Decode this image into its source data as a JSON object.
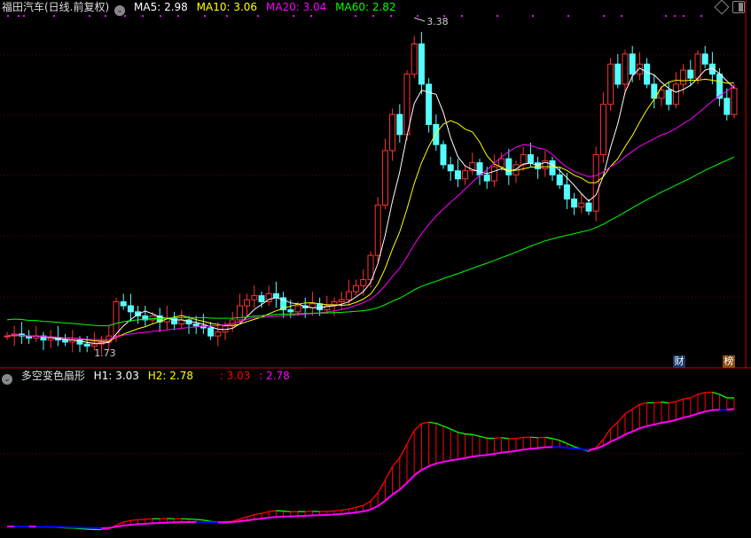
{
  "header": {
    "title": "福田汽车(日线.前复权)",
    "ma5": "MA5: 2.98",
    "ma10": "MA10: 3.06",
    "ma20": "MA20: 3.04",
    "ma60": "MA60: 2.82"
  },
  "indicator": {
    "title": "多空变色扇形",
    "h1": "H1: 3.03",
    "h2": "H2: 2.78",
    "v1": ": 3.03",
    "v2": ": 2.78"
  },
  "annotations": {
    "high": "3.38",
    "low": "1.73"
  },
  "badges": {
    "finance": "财",
    "rank": "榜"
  },
  "colors": {
    "up": "#ff3232",
    "down": "#54ffff",
    "ma5": "#ffffff",
    "ma10": "#ffff00",
    "ma20": "#ff00ff",
    "ma60": "#00ff00"
  },
  "chart_data": {
    "type": "candlestick",
    "ylim": [
      1.73,
      3.38
    ],
    "close": [
      1.8,
      1.81,
      1.8,
      1.79,
      1.8,
      1.78,
      1.79,
      1.78,
      1.77,
      1.78,
      1.76,
      1.75,
      1.76,
      1.77,
      1.8,
      1.97,
      1.95,
      1.92,
      1.9,
      1.88,
      1.9,
      1.87,
      1.89,
      1.86,
      1.88,
      1.86,
      1.85,
      1.84,
      1.8,
      1.82,
      1.85,
      1.88,
      1.95,
      1.98,
      2.0,
      1.97,
      2.01,
      1.99,
      1.93,
      1.92,
      1.95,
      1.94,
      1.96,
      1.93,
      1.95,
      1.97,
      1.98,
      2.02,
      2.05,
      2.08,
      2.2,
      2.45,
      2.72,
      2.9,
      2.8,
      3.1,
      3.25,
      3.05,
      2.85,
      2.75,
      2.65,
      2.62,
      2.58,
      2.62,
      2.66,
      2.6,
      2.57,
      2.64,
      2.68,
      2.6,
      2.65,
      2.7,
      2.66,
      2.63,
      2.67,
      2.6,
      2.55,
      2.48,
      2.44,
      2.46,
      2.42,
      2.7,
      2.95,
      3.15,
      3.05,
      3.2,
      3.1,
      3.15,
      3.05,
      2.98,
      3.02,
      2.95,
      3.05,
      3.12,
      3.08,
      3.2,
      3.15,
      3.1,
      2.98,
      2.9,
      3.03
    ],
    "moving_averages": [
      5,
      10,
      20,
      60
    ],
    "indicator_ylim": [
      1.75,
      3.15
    ]
  }
}
